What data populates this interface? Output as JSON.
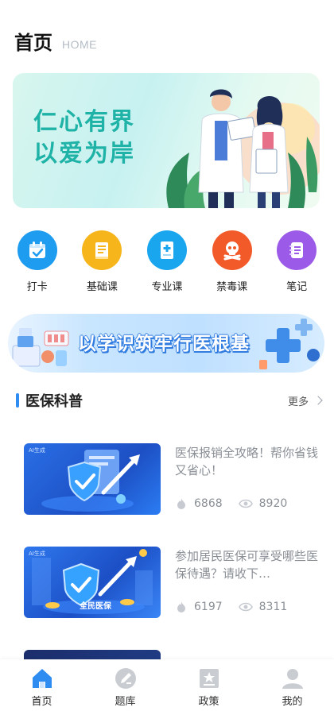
{
  "header": {
    "title": "首页",
    "subtitle": "HOME"
  },
  "hero": {
    "line1": "仁心有界",
    "line2": "以爱为岸"
  },
  "menu": [
    {
      "label": "打卡",
      "icon": "calendar-check-icon",
      "color": "#1e9cf0"
    },
    {
      "label": "基础课",
      "icon": "document-icon",
      "color": "#f5b51b"
    },
    {
      "label": "专业课",
      "icon": "medical-file-icon",
      "color": "#1aa6ee"
    },
    {
      "label": "禁毒课",
      "icon": "skull-crossbones-icon",
      "color": "#f25a2a"
    },
    {
      "label": "笔记",
      "icon": "notebook-icon",
      "color": "#9b5be8"
    }
  ],
  "slogan": {
    "text": "以学识筑牢行医根基"
  },
  "section": {
    "title": "医保科普",
    "more": "更多"
  },
  "articles": [
    {
      "title": "医保报销全攻略！帮你省钱又省心！",
      "views": "6868",
      "likes": "8920",
      "thumb_tag": "AI生成"
    },
    {
      "title": "参加居民医保可享受哪些医保待遇？请收下…",
      "views": "6197",
      "likes": "8311",
      "thumb_tag": "AI生成",
      "thumb_caption": "全民医保"
    }
  ],
  "tabs": [
    {
      "label": "首页",
      "icon": "home-icon",
      "active": true
    },
    {
      "label": "题库",
      "icon": "pen-icon",
      "active": false
    },
    {
      "label": "政策",
      "icon": "policy-icon",
      "active": false
    },
    {
      "label": "我的",
      "icon": "user-icon",
      "active": false
    }
  ],
  "colors": {
    "accent": "#2f8cf0",
    "hero_text": "#1fb2a6",
    "muted": "#8a8f96"
  }
}
